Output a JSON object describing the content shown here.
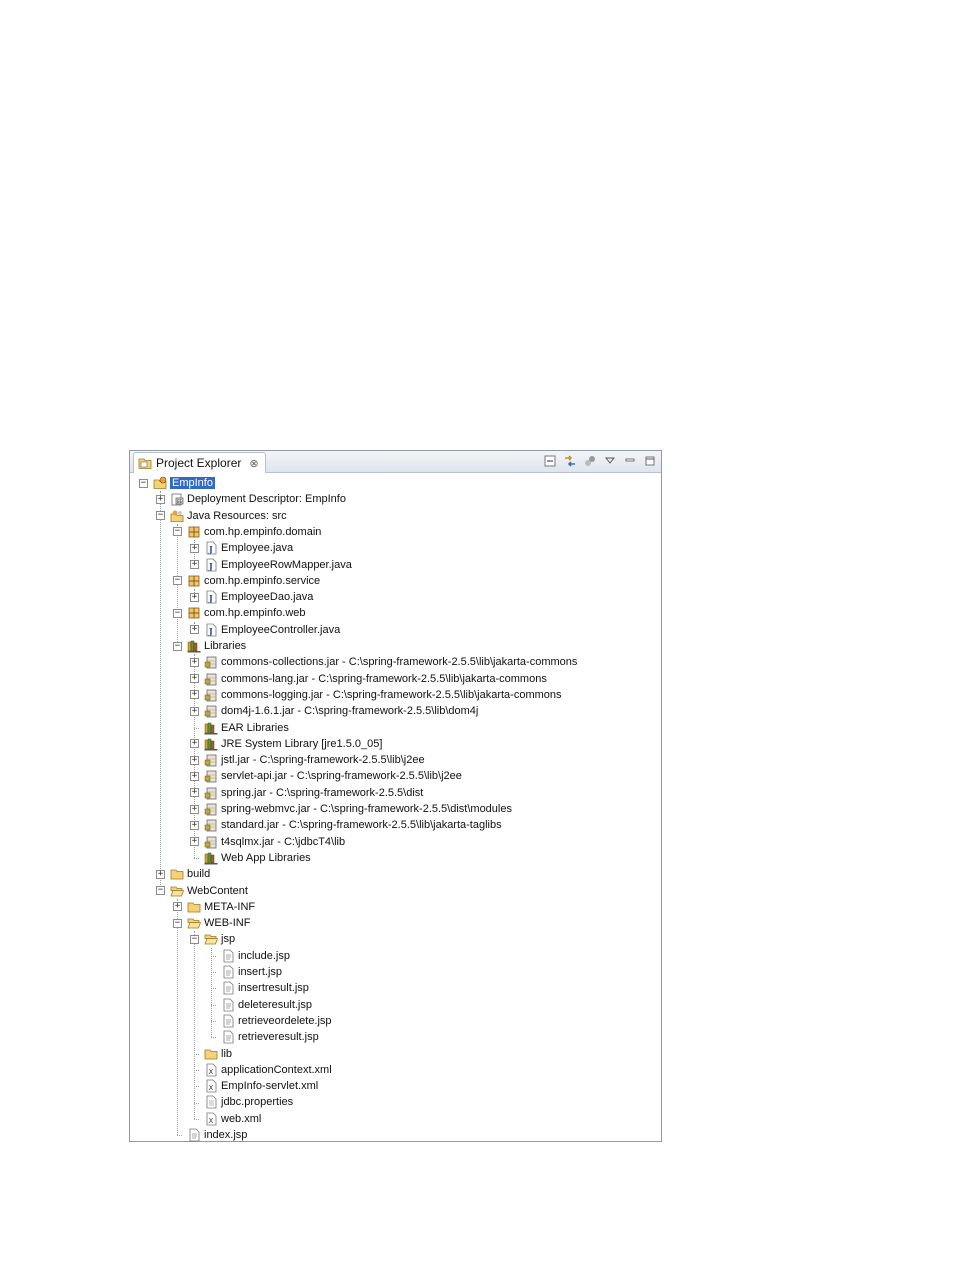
{
  "panel": {
    "tab_title": "Project Explorer",
    "tab_close": "⊗",
    "toolbar_icons": [
      "collapse-all-icon",
      "link-with-editor-icon",
      "filters-icon",
      "view-menu-icon",
      "minimize-icon",
      "maximize-icon"
    ]
  },
  "tree": [
    {
      "label": "EmpInfo",
      "icon": "project-icon",
      "expander": "minus",
      "selected": true
    },
    {
      "label": "Deployment Descriptor: EmpInfo",
      "icon": "deployment-descriptor-icon",
      "expander": "plus"
    },
    {
      "label": "Java Resources: src",
      "icon": "java-resources-icon",
      "expander": "minus"
    },
    {
      "label": "com.hp.empinfo.domain",
      "icon": "package-icon",
      "expander": "minus"
    },
    {
      "label": "Employee.java",
      "icon": "java-file-icon",
      "expander": "plus"
    },
    {
      "label": "EmployeeRowMapper.java",
      "icon": "java-file-icon",
      "expander": "plus"
    },
    {
      "label": "com.hp.empinfo.service",
      "icon": "package-icon",
      "expander": "minus"
    },
    {
      "label": "EmployeeDao.java",
      "icon": "java-file-icon",
      "expander": "plus"
    },
    {
      "label": "com.hp.empinfo.web",
      "icon": "package-icon",
      "expander": "minus"
    },
    {
      "label": "EmployeeController.java",
      "icon": "java-file-icon",
      "expander": "plus"
    },
    {
      "label": "Libraries",
      "icon": "library-icon",
      "expander": "minus"
    },
    {
      "label": "commons-collections.jar - C:\\spring-framework-2.5.5\\lib\\jakarta-commons",
      "icon": "jar-icon",
      "expander": "plus"
    },
    {
      "label": "commons-lang.jar - C:\\spring-framework-2.5.5\\lib\\jakarta-commons",
      "icon": "jar-icon",
      "expander": "plus"
    },
    {
      "label": "commons-logging.jar - C:\\spring-framework-2.5.5\\lib\\jakarta-commons",
      "icon": "jar-icon",
      "expander": "plus"
    },
    {
      "label": "dom4j-1.6.1.jar - C:\\spring-framework-2.5.5\\lib\\dom4j",
      "icon": "jar-icon",
      "expander": "plus"
    },
    {
      "label": "EAR Libraries",
      "icon": "library-icon",
      "expander": "none"
    },
    {
      "label": "JRE System Library [jre1.5.0_05]",
      "icon": "library-icon",
      "expander": "plus"
    },
    {
      "label": "jstl.jar - C:\\spring-framework-2.5.5\\lib\\j2ee",
      "icon": "jar-icon",
      "expander": "plus"
    },
    {
      "label": "servlet-api.jar - C:\\spring-framework-2.5.5\\lib\\j2ee",
      "icon": "jar-icon",
      "expander": "plus"
    },
    {
      "label": "spring.jar - C:\\spring-framework-2.5.5\\dist",
      "icon": "jar-icon",
      "expander": "plus"
    },
    {
      "label": "spring-webmvc.jar - C:\\spring-framework-2.5.5\\dist\\modules",
      "icon": "jar-icon",
      "expander": "plus"
    },
    {
      "label": "standard.jar - C:\\spring-framework-2.5.5\\lib\\jakarta-taglibs",
      "icon": "jar-icon",
      "expander": "plus"
    },
    {
      "label": "t4sqlmx.jar - C:\\jdbcT4\\lib",
      "icon": "jar-icon",
      "expander": "plus"
    },
    {
      "label": "Web App Libraries",
      "icon": "library-icon",
      "expander": "none"
    },
    {
      "label": "build",
      "icon": "folder-icon",
      "expander": "plus"
    },
    {
      "label": "WebContent",
      "icon": "folder-open-icon",
      "expander": "minus"
    },
    {
      "label": "META-INF",
      "icon": "folder-icon",
      "expander": "plus"
    },
    {
      "label": "WEB-INF",
      "icon": "folder-open-icon",
      "expander": "minus"
    },
    {
      "label": "jsp",
      "icon": "folder-open-icon",
      "expander": "minus"
    },
    {
      "label": "include.jsp",
      "icon": "jsp-file-icon",
      "expander": "none"
    },
    {
      "label": "insert.jsp",
      "icon": "jsp-file-icon",
      "expander": "none"
    },
    {
      "label": "insertresult.jsp",
      "icon": "jsp-file-icon",
      "expander": "none"
    },
    {
      "label": "deleteresult.jsp",
      "icon": "jsp-file-icon",
      "expander": "none"
    },
    {
      "label": "retrieveordelete.jsp",
      "icon": "jsp-file-icon",
      "expander": "none"
    },
    {
      "label": "retrieveresult.jsp",
      "icon": "jsp-file-icon",
      "expander": "none"
    },
    {
      "label": "lib",
      "icon": "folder-icon",
      "expander": "none"
    },
    {
      "label": "applicationContext.xml",
      "icon": "xml-file-icon",
      "expander": "none"
    },
    {
      "label": "EmpInfo-servlet.xml",
      "icon": "xml-file-icon",
      "expander": "none"
    },
    {
      "label": "jdbc.properties",
      "icon": "properties-file-icon",
      "expander": "none"
    },
    {
      "label": "web.xml",
      "icon": "xml-file-icon",
      "expander": "none"
    },
    {
      "label": "index.jsp",
      "icon": "jsp-file-icon",
      "expander": "none"
    }
  ]
}
